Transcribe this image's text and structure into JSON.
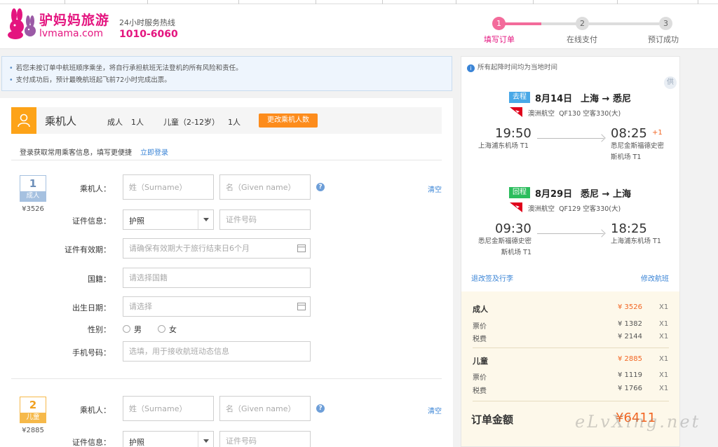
{
  "header": {
    "logo_cn": "驴妈妈旅游",
    "logo_en": "lvmama.com",
    "hotline_label": "24小时服务热线",
    "hotline_number": "1010-6060",
    "steps": [
      {
        "num": "1",
        "label": "填写订单",
        "active": true
      },
      {
        "num": "2",
        "label": "在线支付",
        "active": false
      },
      {
        "num": "3",
        "label": "预订成功",
        "active": false
      }
    ]
  },
  "notice": {
    "lines": [
      "若您未按订单中航班顺序乘坐，将自行承担航班无法登机的所有风险和责任。",
      "支付成功后，预计最晚航班起飞前72小时完成出票。"
    ]
  },
  "passengers": {
    "title": "乘机人",
    "adult_label": "成人",
    "adult_count": "1人",
    "child_label": "儿童（2-12岁）",
    "child_count": "1人",
    "change_button": "更改乘机人数",
    "login_tip": "登录获取常用乘客信息，填写更便捷",
    "login_link": "立即登录",
    "labels": {
      "name": "乘机人：",
      "id_info": "证件信息：",
      "id_expiry": "证件有效期：",
      "nationality": "国籍：",
      "birthday": "出生日期：",
      "gender": "性别：",
      "phone": "手机号码："
    },
    "placeholders": {
      "surname": "姓（Surname）",
      "given_name": "名（Given name）",
      "id_number": "证件号码",
      "id_expiry": "请确保有效期大于旅行结束日6个月",
      "nationality": "请选择国籍",
      "birthday": "请选择",
      "phone": "选填，用于接收航班动态信息"
    },
    "id_type": "护照",
    "gender_male": "男",
    "gender_female": "女",
    "clear": "清空",
    "help": "?",
    "cards": [
      {
        "num": "1",
        "tag": "成人",
        "price": "¥3526"
      },
      {
        "num": "2",
        "tag": "儿童",
        "price": "¥2885"
      }
    ]
  },
  "side": {
    "tip": "所有起降时间均为当地时间",
    "tip_icon": "i",
    "gong_badge": "供",
    "segments": [
      {
        "tag": "去程",
        "date": "8月14日",
        "route": "上海 → 悉尼",
        "airline": "澳洲航空",
        "flight": "QF130 空客330(大)",
        "dep_time": "19:50",
        "arr_time": "08:25",
        "plus_day": "+1",
        "dep_airport": "上海浦东机场 T1",
        "arr_airport": "悉尼金斯福德史密斯机场 T1"
      },
      {
        "tag": "回程",
        "date": "8月29日",
        "route": "悉尼 → 上海",
        "airline": "澳洲航空",
        "flight": "QF129 空客330(大)",
        "dep_time": "09:30",
        "arr_time": "18:25",
        "plus_day": "",
        "dep_airport": "悉尼金斯福德史密斯机场 T1",
        "arr_airport": "上海浦东机场 T1"
      }
    ],
    "refund_link": "退改签及行李",
    "modify_link": "修改航班",
    "prices": {
      "adult": {
        "label": "成人",
        "amount": "¥ 3526",
        "qty": "X1"
      },
      "adult_ticket": {
        "label": "票价",
        "amount": "¥ 1382",
        "qty": "X1"
      },
      "adult_tax": {
        "label": "税费",
        "amount": "¥ 2144",
        "qty": "X1"
      },
      "child": {
        "label": "儿童",
        "amount": "¥ 2885",
        "qty": "X1"
      },
      "child_ticket": {
        "label": "票价",
        "amount": "¥ 1119",
        "qty": "X1"
      },
      "child_tax": {
        "label": "税费",
        "amount": "¥ 1766",
        "qty": "X1"
      }
    },
    "total_label": "订单金额",
    "total_amount": "¥6411"
  },
  "watermark": "eLvXing.net",
  "colors": {
    "brand": "#e4147f",
    "orange": "#fd8c1c",
    "link": "#3a84d6",
    "price": "#f26522"
  }
}
